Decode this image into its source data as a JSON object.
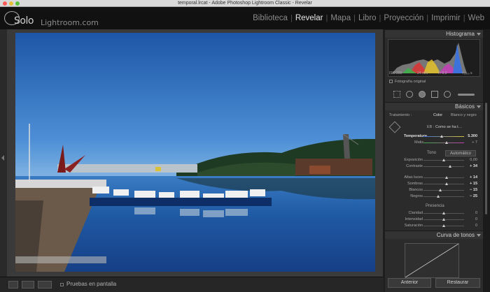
{
  "window": {
    "title": "temporal.lrcat - Adobe Photoshop Lightroom Classic - Revelar"
  },
  "header": {
    "logo_solo": "Solo",
    "logo_site": "Lightroom.com",
    "modules": [
      "Biblioteca",
      "Revelar",
      "Mapa",
      "Libro",
      "Proyección",
      "Imprimir",
      "Web"
    ],
    "active_module": "Revelar"
  },
  "toolbar": {
    "proof_label": "Pruebas en pantalla"
  },
  "histogram": {
    "title": "Histograma",
    "iso": "ISO 200",
    "focal": "24 mm",
    "aperture": "f / 8,0",
    "shutter": "¹⁄₂₀₀₀ s",
    "original_label": "Fotografía original"
  },
  "basic": {
    "title": "Básicos",
    "treatment_label": "Tratamiento :",
    "treatment_color": "Color",
    "treatment_bw": "Blanco y negro",
    "wb_label": "EB :",
    "wb_value": "Como se ha t…",
    "temperature_label": "Temperatura",
    "temperature_value": "5.300",
    "tint_label": "Matiz",
    "tint_value": "+ 7",
    "tone_label": "Tono",
    "auto_label": "Automático",
    "exposure_label": "Exposición",
    "exposure_value": "0,00",
    "contrast_label": "Contraste",
    "contrast_value": "+ 34",
    "highlights_label": "Altas luces",
    "highlights_value": "+ 14",
    "shadows_label": "Sombras",
    "shadows_value": "+ 15",
    "whites_label": "Blancos",
    "whites_value": "− 15",
    "blacks_label": "Negros",
    "blacks_value": "− 25",
    "presence_label": "Presencia",
    "clarity_label": "Claridad",
    "clarity_value": "0",
    "vibrance_label": "Intensidad",
    "vibrance_value": "0",
    "saturation_label": "Saturación",
    "saturation_value": "0"
  },
  "tone_curve": {
    "title": "Curva de tonos"
  },
  "buttons": {
    "previous": "Anterior",
    "reset": "Restaurar"
  },
  "colors": {
    "accent_active": "#e8e8e8",
    "panel_bg": "#2b2b2b",
    "sky_top": "#1f5ba8",
    "sky_bottom": "#5a9ad8"
  }
}
